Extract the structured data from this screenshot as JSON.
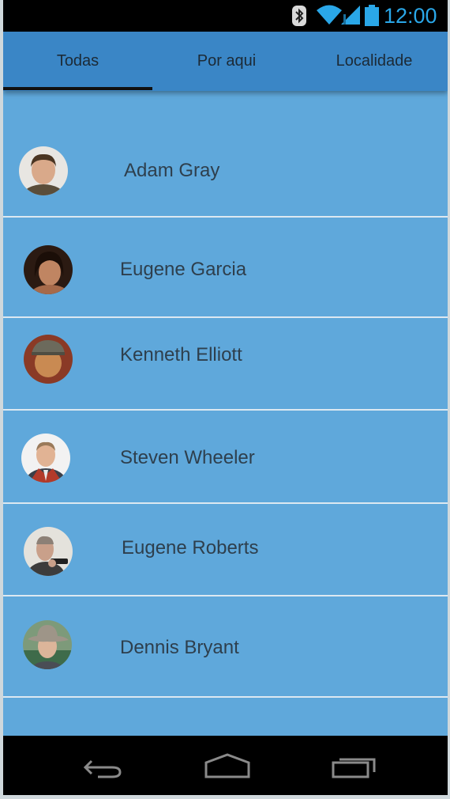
{
  "status_bar": {
    "time": "12:00",
    "icons": [
      "bluetooth-icon",
      "wifi-icon",
      "signal-icon",
      "battery-icon"
    ],
    "accent_color": "#2aa7e8"
  },
  "tabs": [
    {
      "label": "Todas",
      "selected": true
    },
    {
      "label": "Por aqui",
      "selected": false
    },
    {
      "label": "Localidade",
      "selected": false
    }
  ],
  "contacts": [
    {
      "name": "Adam Gray"
    },
    {
      "name": "Eugene Garcia"
    },
    {
      "name": "Kenneth Elliott"
    },
    {
      "name": "Steven Wheeler"
    },
    {
      "name": "Eugene Roberts"
    },
    {
      "name": "Dennis Bryant"
    }
  ],
  "nav_bar": {
    "icons": [
      "back-icon",
      "home-icon",
      "recents-icon"
    ]
  },
  "colors": {
    "list_background": "#5fa8db",
    "tab_background": "#3a86c6",
    "divider": "#dce8f1"
  }
}
